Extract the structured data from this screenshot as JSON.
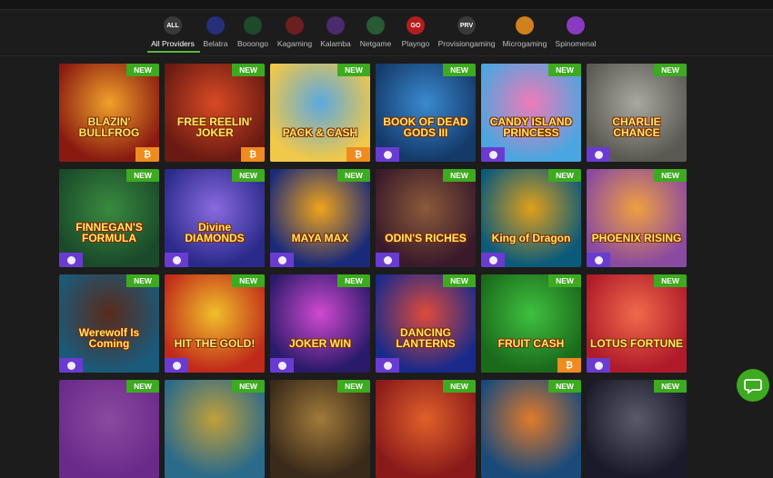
{
  "providers": [
    {
      "label": "All Providers",
      "icon": "all-badge-icon",
      "icon_text": "ALL",
      "color": "#3a3a3a",
      "active": true
    },
    {
      "label": "Belatra",
      "icon": "belatra-logo-icon",
      "icon_text": "",
      "color": "#24307a",
      "active": false
    },
    {
      "label": "Booongo",
      "icon": "booongo-logo-icon",
      "icon_text": "",
      "color": "#1c4a2a",
      "active": false
    },
    {
      "label": "Kagaming",
      "icon": "kagaming-logo-icon",
      "icon_text": "",
      "color": "#6b1f1f",
      "active": false
    },
    {
      "label": "Kalamba",
      "icon": "kalamba-logo-icon",
      "icon_text": "",
      "color": "#4b2a6e",
      "active": false
    },
    {
      "label": "Netgame",
      "icon": "netgame-logo-icon",
      "icon_text": "",
      "color": "#275a35",
      "active": false
    },
    {
      "label": "Playngo",
      "icon": "playngo-logo-icon",
      "icon_text": "GO",
      "color": "#b51d1d",
      "active": false
    },
    {
      "label": "Provisiongaming",
      "icon": "provisiongaming-logo-icon",
      "icon_text": "PRV",
      "color": "#3a3a3a",
      "active": false
    },
    {
      "label": "Microgaming",
      "icon": "microgaming-logo-icon",
      "icon_text": "",
      "color": "#d0811d",
      "active": false
    },
    {
      "label": "Spinomenal",
      "icon": "spinomenal-logo-icon",
      "icon_text": "",
      "color": "#8a3ac0",
      "active": false
    }
  ],
  "badge_label": "NEW",
  "games": [
    {
      "title": "BLAZIN' BULLFROG",
      "bg": "#8a1a10",
      "accent": "#f0a22a",
      "corner": "btc"
    },
    {
      "title": "FREE REELIN' JOKER",
      "bg": "#6a1a12",
      "accent": "#d94a24",
      "corner": "btc"
    },
    {
      "title": "PACK & CASH",
      "bg": "#f0c84a",
      "accent": "#5aa8e0",
      "corner": "btc"
    },
    {
      "title": "BOOK OF DEAD GODS III",
      "bg": "#143a6a",
      "accent": "#3a8ad0",
      "corner": "coin"
    },
    {
      "title": "CANDY ISLAND PRINCESS",
      "bg": "#4aa6e0",
      "accent": "#f07ab8",
      "corner": "coin"
    },
    {
      "title": "CHARLIE CHANCE",
      "bg": "#5a5a52",
      "accent": "#a8a8a0",
      "corner": "coin"
    },
    {
      "title": "FINNEGAN'S FORMULA",
      "bg": "#1a4a2a",
      "accent": "#3a8a40",
      "corner": "coin"
    },
    {
      "title": "Divine DIAMONDS",
      "bg": "#2a2a8a",
      "accent": "#8a6ae0",
      "corner": "coin"
    },
    {
      "title": "MAYA MAX",
      "bg": "#1a2a7a",
      "accent": "#f0a41a",
      "corner": "coin"
    },
    {
      "title": "ODIN'S RICHES",
      "bg": "#3a1a2a",
      "accent": "#8a5a3a",
      "corner": "coin"
    },
    {
      "title": "King of Dragon",
      "bg": "#0a5a7a",
      "accent": "#e0a01a",
      "corner": "coin"
    },
    {
      "title": "PHOENIX RISING",
      "bg": "#8a4aa0",
      "accent": "#f0a040",
      "corner": "coin"
    },
    {
      "title": "Werewolf Is Coming",
      "bg": "#1a5a7a",
      "accent": "#5a2a1a",
      "corner": "coin"
    },
    {
      "title": "HIT THE GOLD!",
      "bg": "#c02a1a",
      "accent": "#f0c02a",
      "corner": "coin"
    },
    {
      "title": "JOKER WIN",
      "bg": "#2a1a6a",
      "accent": "#d04ad0",
      "corner": "coin"
    },
    {
      "title": "DANCING LANTERNS",
      "bg": "#1a2a8a",
      "accent": "#e04a3a",
      "corner": "coin"
    },
    {
      "title": "FRUIT CASH",
      "bg": "#1a6a1a",
      "accent": "#40c040",
      "corner": "btc"
    },
    {
      "title": "LOTUS FORTUNE",
      "bg": "#b01a2a",
      "accent": "#f06a4a",
      "corner": "coin"
    },
    {
      "title": "",
      "bg": "#6a2a8a",
      "accent": "#8a4aa0",
      "corner": "none"
    },
    {
      "title": "",
      "bg": "#2a6a8a",
      "accent": "#c0a03a",
      "corner": "none"
    },
    {
      "title": "",
      "bg": "#3a2a1a",
      "accent": "#a07a3a",
      "corner": "none"
    },
    {
      "title": "",
      "bg": "#8a1a1a",
      "accent": "#e0602a",
      "corner": "none"
    },
    {
      "title": "",
      "bg": "#1a4a7a",
      "accent": "#e07a2a",
      "corner": "none"
    },
    {
      "title": "",
      "bg": "#1a1a2a",
      "accent": "#5a5a6a",
      "corner": "none"
    }
  ],
  "colors": {
    "accent": "#3daa1f",
    "background": "#1c1c1c"
  },
  "chat_icon": "chat-bubble-icon"
}
